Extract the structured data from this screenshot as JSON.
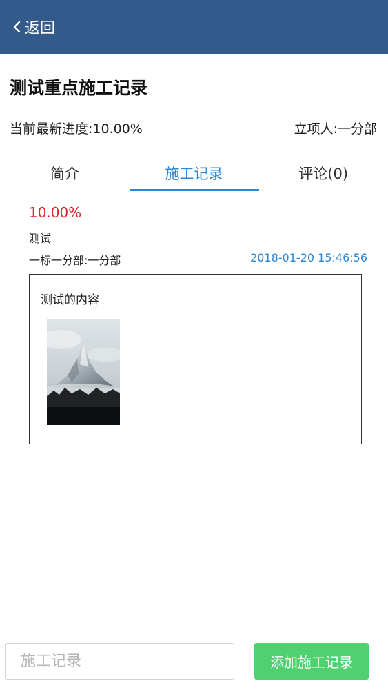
{
  "header": {
    "back_label": "返回",
    "back_icon": "chevron-left-icon",
    "bar_color": "#325a8a"
  },
  "project": {
    "title": "测试重点施工记录",
    "progress_text": "当前最新进度:10.00%",
    "owner_text": "立项人:一分部"
  },
  "tabs": [
    {
      "label": "简介",
      "active": false
    },
    {
      "label": "施工记录",
      "active": true
    },
    {
      "label": "评论(0)",
      "active": false
    }
  ],
  "record": {
    "progress": "10.00%",
    "name": "测试",
    "department": "一标一分部:一分部",
    "timestamp": "2018-01-20 15:46:56",
    "content_title": "测试的内容",
    "photo_icon": "mountain-photo"
  },
  "footer": {
    "input_placeholder": "施工记录",
    "add_button_label": "添加施工记录",
    "add_button_color": "#4fd170"
  },
  "colors": {
    "accent_blue": "#2b86d6",
    "progress_red": "#e0262f"
  }
}
